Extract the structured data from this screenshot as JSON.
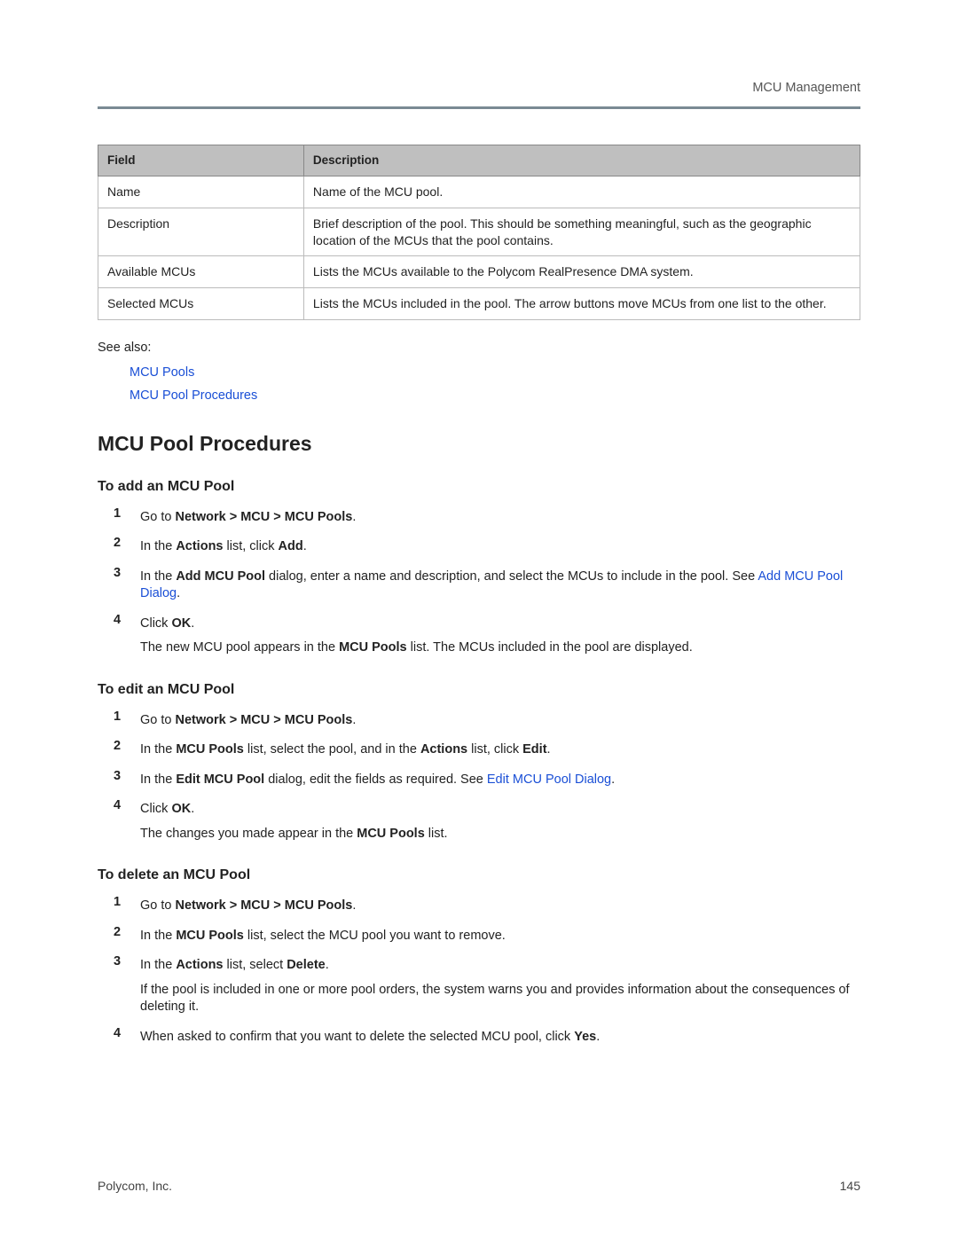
{
  "header": {
    "section": "MCU Management"
  },
  "table": {
    "headers": [
      "Field",
      "Description"
    ],
    "rows": [
      {
        "field": "Name",
        "desc": "Name of the MCU pool."
      },
      {
        "field": "Description",
        "desc": "Brief description of the pool. This should be something meaningful, such as the geographic location of the MCUs that the pool contains."
      },
      {
        "field": "Available MCUs",
        "desc": "Lists the MCUs available to the Polycom RealPresence DMA system."
      },
      {
        "field": "Selected MCUs",
        "desc": "Lists the MCUs included in the pool. The arrow buttons move MCUs from one list to the other."
      }
    ]
  },
  "see_also": {
    "label": "See also:",
    "links": [
      "MCU Pools",
      "MCU Pool Procedures"
    ]
  },
  "section_title": "MCU Pool Procedures",
  "add": {
    "title": "To add an MCU Pool",
    "s1_a": "Go to ",
    "s1_b": "Network > MCU > MCU Pools",
    "s1_c": ".",
    "s2_a": "In the ",
    "s2_b": "Actions",
    "s2_c": " list, click ",
    "s2_d": "Add",
    "s2_e": ".",
    "s3_a": "In the ",
    "s3_b": "Add MCU Pool",
    "s3_c": " dialog, enter a name and description, and select the MCUs to include in the pool. See ",
    "s3_link": "Add MCU Pool Dialog",
    "s3_d": ".",
    "s4_a": "Click ",
    "s4_b": "OK",
    "s4_c": ".",
    "s4_follow_a": "The new MCU pool appears in the ",
    "s4_follow_b": "MCU Pools",
    "s4_follow_c": " list. The MCUs included in the pool are displayed."
  },
  "edit": {
    "title": "To edit an MCU Pool",
    "s1_a": "Go to ",
    "s1_b": "Network > MCU > MCU Pools",
    "s1_c": ".",
    "s2_a": "In the ",
    "s2_b": "MCU Pools",
    "s2_c": " list, select the pool, and in the ",
    "s2_d": "Actions",
    "s2_e": " list, click ",
    "s2_f": "Edit",
    "s2_g": ".",
    "s3_a": "In the ",
    "s3_b": "Edit MCU Pool",
    "s3_c": " dialog, edit the fields as required. See ",
    "s3_link": "Edit MCU Pool Dialog",
    "s3_d": ".",
    "s4_a": "Click ",
    "s4_b": "OK",
    "s4_c": ".",
    "s4_follow_a": "The changes you made appear in the ",
    "s4_follow_b": "MCU Pools",
    "s4_follow_c": " list."
  },
  "del": {
    "title": "To delete an MCU Pool",
    "s1_a": "Go to ",
    "s1_b": "Network > MCU > MCU Pools",
    "s1_c": ".",
    "s2_a": "In the ",
    "s2_b": "MCU Pools",
    "s2_c": " list, select the MCU pool you want to remove.",
    "s3_a": "In the ",
    "s3_b": "Actions",
    "s3_c": " list, select ",
    "s3_d": "Delete",
    "s3_e": ".",
    "s3_follow": "If the pool is included in one or more pool orders, the system warns you and provides information about the consequences of deleting it.",
    "s4_a": "When asked to confirm that you want to delete the selected MCU pool, click ",
    "s4_b": "Yes",
    "s4_c": "."
  },
  "footer": {
    "left": "Polycom, Inc.",
    "right": "145"
  }
}
